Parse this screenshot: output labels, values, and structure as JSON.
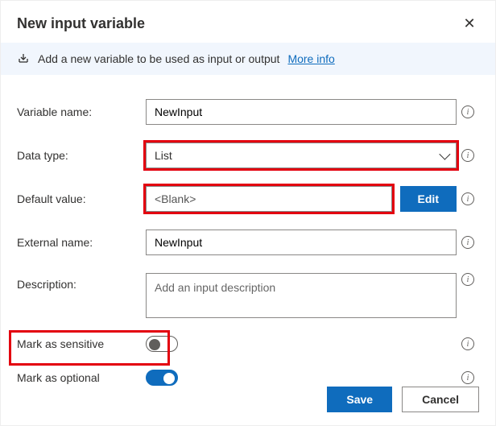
{
  "dialog": {
    "title": "New input variable",
    "info_text": "Add a new variable to be used as input or output",
    "more_info_label": "More info"
  },
  "fields": {
    "variable_name": {
      "label": "Variable name:",
      "value": "NewInput"
    },
    "data_type": {
      "label": "Data type:",
      "value": "List"
    },
    "default_value": {
      "label": "Default value:",
      "value": "<Blank>",
      "edit_label": "Edit"
    },
    "external_name": {
      "label": "External name:",
      "value": "NewInput"
    },
    "description": {
      "label": "Description:",
      "placeholder": "Add an input description"
    },
    "sensitive": {
      "label": "Mark as sensitive",
      "value": false
    },
    "optional": {
      "label": "Mark as optional",
      "value": true
    }
  },
  "footer": {
    "save": "Save",
    "cancel": "Cancel"
  },
  "colors": {
    "accent": "#0f6cbd",
    "highlight": "#e3000f"
  }
}
